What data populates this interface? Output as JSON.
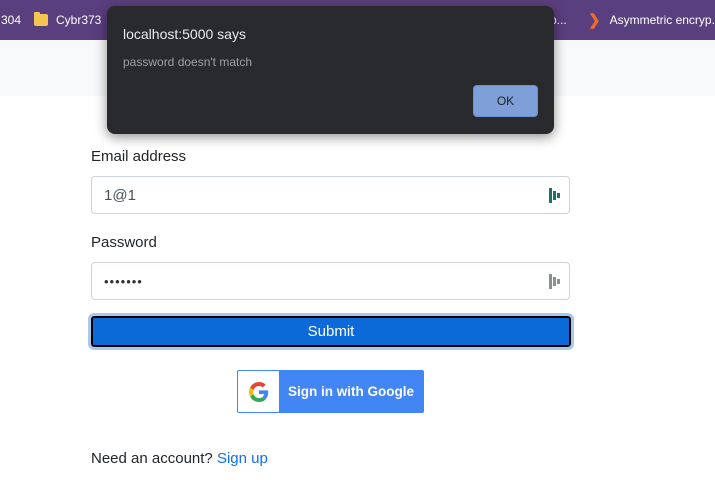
{
  "bookmarks": [
    {
      "label": "304"
    },
    {
      "label": "Cybr373"
    },
    {
      "label": "p..."
    },
    {
      "label": "Asymmetric encryp..."
    }
  ],
  "dialog": {
    "title": "localhost:5000 says",
    "message": "password doesn't match",
    "ok_label": "OK"
  },
  "form": {
    "email_label": "Email address",
    "email_value": "1@1",
    "password_label": "Password",
    "password_value": "•••••••",
    "submit_label": "Submit",
    "google_label": "Sign in with Google",
    "need_account_text": "Need an account?",
    "signup_link": "Sign up"
  },
  "icons": {
    "folder": "folder-icon",
    "bookmark_chevron": "chevron-right-icon",
    "password_manager": "password-manager-icon",
    "google": "google-g-icon"
  },
  "colors": {
    "bookmarks_bar": "#5a3f7e",
    "dialog_bg": "#292a2d",
    "ok_button": "#7f9fd8",
    "primary": "#0b6ad8",
    "google_blue": "#4285f4",
    "link": "#0d6efd",
    "pw_icon_active": "#1e6f66",
    "pw_icon_idle": "#8a8f96"
  }
}
